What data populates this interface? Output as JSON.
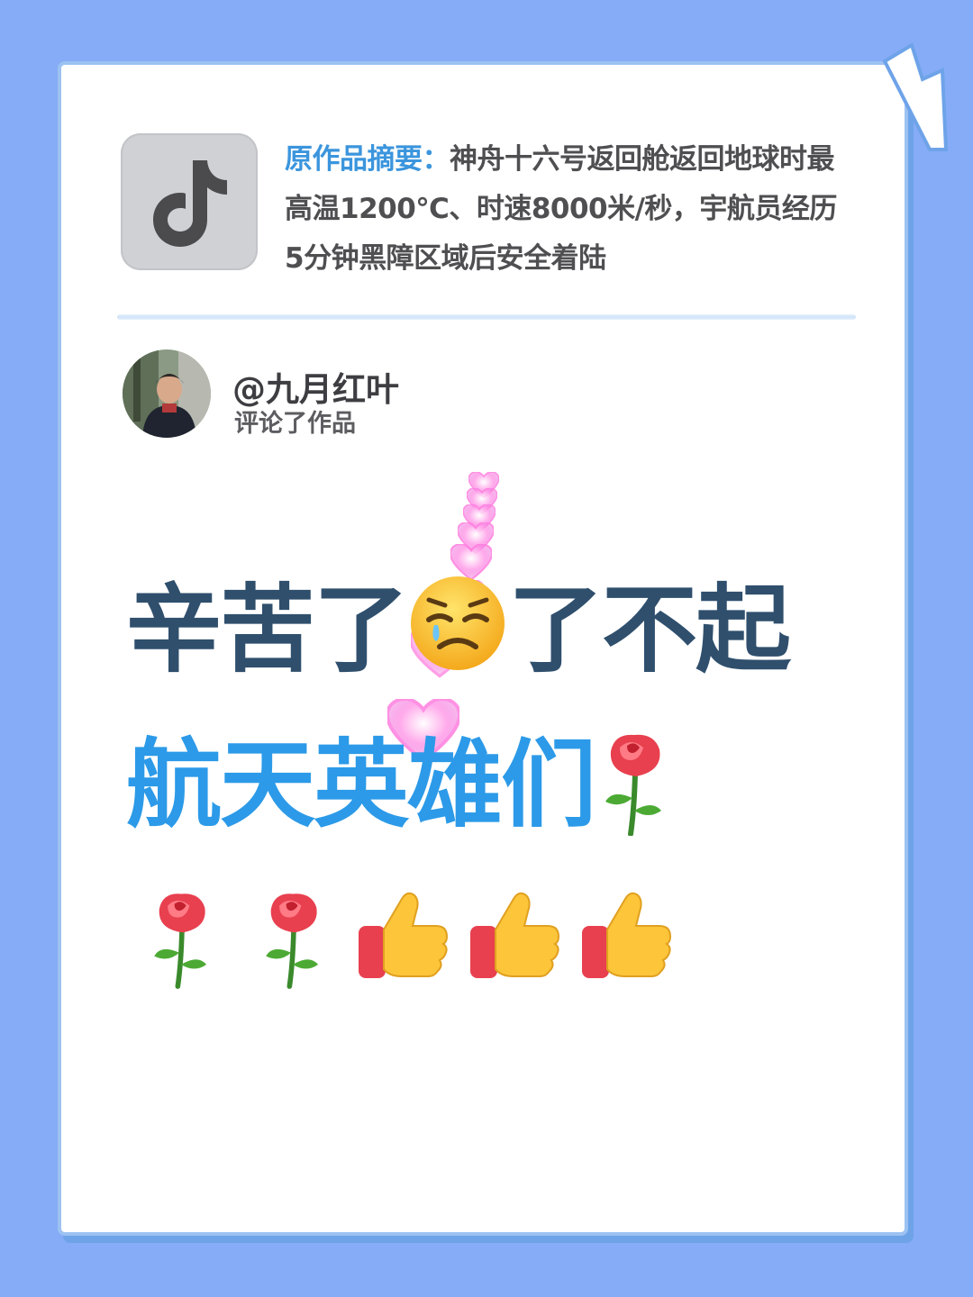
{
  "summary": {
    "label": "原作品摘要：",
    "text": "神舟十六号返回舱返回地球时最高温1200℃、时速8000米/秒，宇航员经历5分钟黑障区域后安全着陆"
  },
  "commenter": {
    "username": "@九月红叶",
    "action": "评论了作品"
  },
  "comment": {
    "line1_part1": "辛苦了",
    "line1_part2": "了不起",
    "line2": "航天英雄们"
  },
  "icons": {
    "app_logo": "tiktok-icon",
    "emoji_1": "tired-face-icon",
    "roses": [
      "rose-icon",
      "rose-icon",
      "rose-icon"
    ],
    "thumbs": [
      "thumbs-up-icon",
      "thumbs-up-icon",
      "thumbs-up-icon"
    ],
    "effect": "floating-hearts-icon"
  },
  "colors": {
    "background": "#86acf7",
    "summary_label": "#3b95dd",
    "comment_line1": "#2f4f6d",
    "comment_line2": "#2c9ae8"
  }
}
